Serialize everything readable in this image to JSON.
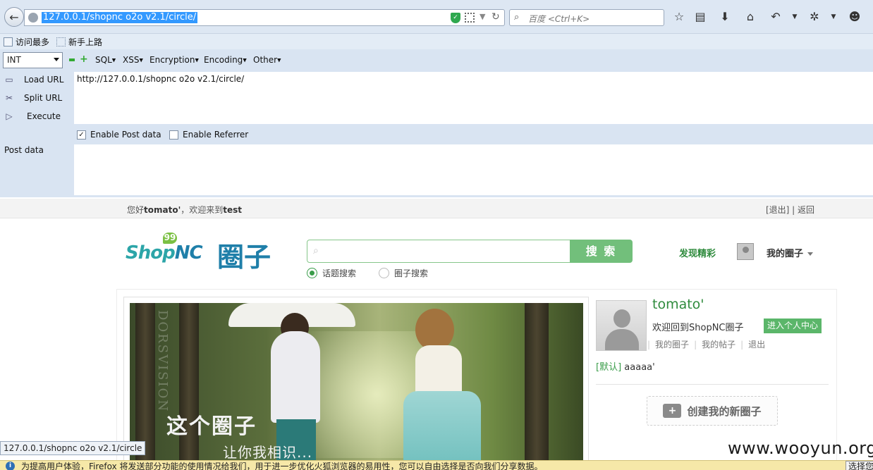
{
  "browser": {
    "url": "127.0.0.1/shopnc o2o v2.1/circle/",
    "search_placeholder": "百度 <Ctrl+K>",
    "toolbar_icons": [
      "star-icon",
      "reading-list-icon",
      "download-icon",
      "home-icon",
      "undo-icon",
      "extension-icon",
      "smiley-icon"
    ]
  },
  "bookmarks": {
    "items": [
      {
        "label": "访问最多",
        "icon": "bookmark-icon"
      },
      {
        "label": "新手上路",
        "icon": "dotted-page-icon"
      }
    ]
  },
  "hackbar": {
    "select_value": "INT",
    "menus": [
      "SQL",
      "XSS",
      "Encryption",
      "Encoding",
      "Other"
    ],
    "actions": [
      "Load URL",
      "Split URL",
      "Execute"
    ],
    "url_value": "http://127.0.0.1/shopnc o2o v2.1/circle/",
    "enable_post_label": "Enable Post data",
    "enable_post_checked": true,
    "enable_referrer_label": "Enable Referrer",
    "enable_referrer_checked": false,
    "post_label": "Post data",
    "post_value": ""
  },
  "page": {
    "greeting_prefix": "您好",
    "greeting_user": "tomato'",
    "greeting_mid": "，欢迎来到",
    "greeting_site": "test",
    "top_links": "[退出]  |  返回",
    "logo_text_shop": "Shop",
    "logo_text_nc": "NC",
    "logo_text_cn": "圈子",
    "logo_bubble": "99",
    "search_value": "",
    "search_button": "搜 索",
    "radio_topic": "话题搜索",
    "radio_circle": "圈子搜索",
    "radio_selected": "topic",
    "discover": "发现精彩",
    "my_circle": "我的圈子",
    "banner_title": "这个圈子",
    "banner_subtitle": "让你我相识...",
    "banner_vertical_text": "DORSVISION",
    "status_url": "127.0.0.1/shopnc o2o v2.1/circle",
    "sidebar": {
      "username": "tomato'",
      "welcome": "欢迎回到ShopNC圈子",
      "center_button": "进入个人中心",
      "links": [
        "我的圈子",
        "我的帖子",
        "退出"
      ],
      "default_tag": "[默认]",
      "default_name": "aaaaa'",
      "create_button": "创建我的新圈子"
    }
  },
  "watermark": "www.wooyun.org",
  "notification": {
    "text": "为提高用户体验，Firefox 将发送部分功能的使用情况给我们，用于进一步优化火狐浏览器的易用性，您可以自由选择是否向我们分享数据。",
    "button": "选择您要分享的数据"
  }
}
